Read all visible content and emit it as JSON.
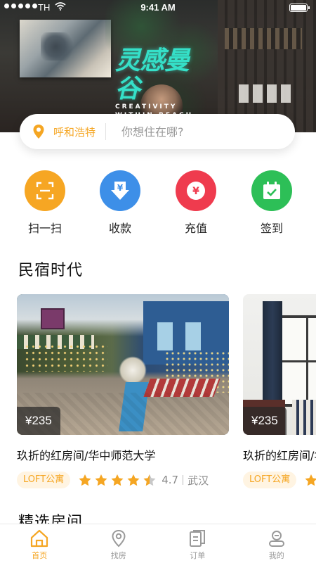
{
  "status_bar": {
    "carrier": "TH",
    "time": "9:41 AM"
  },
  "hero": {
    "brand_cn": "灵感曼谷",
    "brand_en_line1": "CREATIVITY",
    "brand_en_line2": "WITHIN REACH"
  },
  "search": {
    "city": "呼和浩特",
    "placeholder": "你想住在哪?"
  },
  "colors": {
    "accent": "#f5a623",
    "scan": "#f6a623",
    "receive": "#3d8fe8",
    "topup": "#ef3b4e",
    "checkin": "#2dbf57"
  },
  "actions": [
    {
      "label": "扫一扫",
      "icon": "scan-icon"
    },
    {
      "label": "收款",
      "icon": "receive-money-icon"
    },
    {
      "label": "充值",
      "icon": "topup-icon"
    },
    {
      "label": "签到",
      "icon": "calendar-check-icon"
    }
  ],
  "section_title": "民宿时代",
  "cards": [
    {
      "price": "¥235",
      "title": "玖折的红房间/华中师范大学",
      "tag": "LOFT公寓",
      "rating": "4.7",
      "rating_value": 4.7,
      "stars_total": 5,
      "location": "武汉"
    },
    {
      "price": "¥235",
      "title": "玖折的红房间/华中师范大学",
      "tag": "LOFT公寓"
    }
  ],
  "next_section_title": "精选房间",
  "tabbar": [
    {
      "label": "首页",
      "icon": "home-icon",
      "active": true
    },
    {
      "label": "找房",
      "icon": "location-pin-icon",
      "active": false
    },
    {
      "label": "订单",
      "icon": "orders-icon",
      "active": false
    },
    {
      "label": "我的",
      "icon": "profile-icon",
      "active": false
    }
  ]
}
